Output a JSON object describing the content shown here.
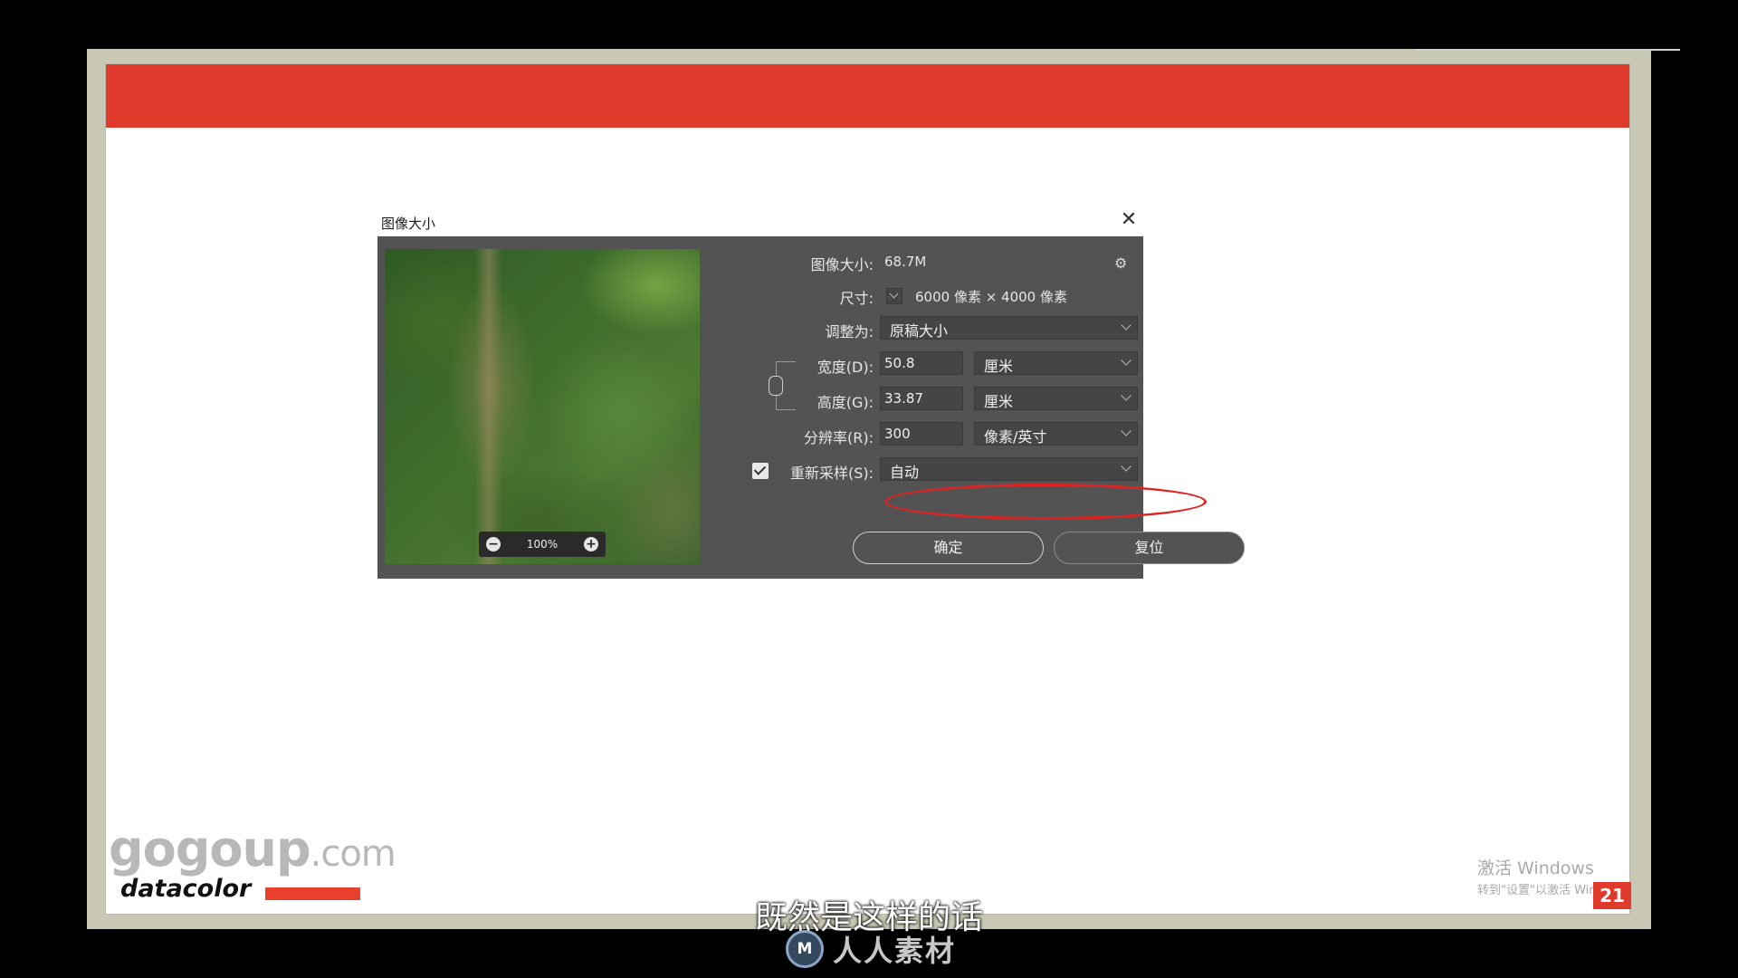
{
  "dialog": {
    "title": "图像大小",
    "close_glyph": "✕",
    "image_size_label": "图像大小:",
    "image_size_value": "68.7M",
    "gear_glyph": "⚙",
    "dimensions_label": "尺寸:",
    "dimensions_value": "6000 像素 × 4000 像素",
    "fit_to_label": "调整为:",
    "fit_to_value": "原稿大小",
    "width_label": "宽度(D):",
    "width_value": "50.8",
    "width_unit": "厘米",
    "height_label": "高度(G):",
    "height_value": "33.87",
    "height_unit": "厘米",
    "resolution_label": "分辨率(R):",
    "resolution_value": "300",
    "resolution_unit": "像素/英寸",
    "resample_label": "重新采样(S):",
    "resample_value": "自动",
    "resample_checked": true,
    "ok_label": "确定",
    "reset_label": "复位",
    "zoom_level": "100%",
    "zoom_out_glyph": "−",
    "zoom_in_glyph": "+"
  },
  "overlay": {
    "watermark_main": "gogoup",
    "watermark_domain": ".com",
    "brand": "datacolor",
    "activate_windows_title": "激活 Windows",
    "activate_windows_sub": "转到\"设置\"以激活 Windows。",
    "page_number": "21",
    "subtitle": "既然是这样的话",
    "site_logo_icon": "M",
    "site_logo_text": "人人素材"
  },
  "colors": {
    "banner_red": "#e03a2c",
    "highlight_ellipse": "#e12222",
    "dialog_panel": "#535353"
  }
}
